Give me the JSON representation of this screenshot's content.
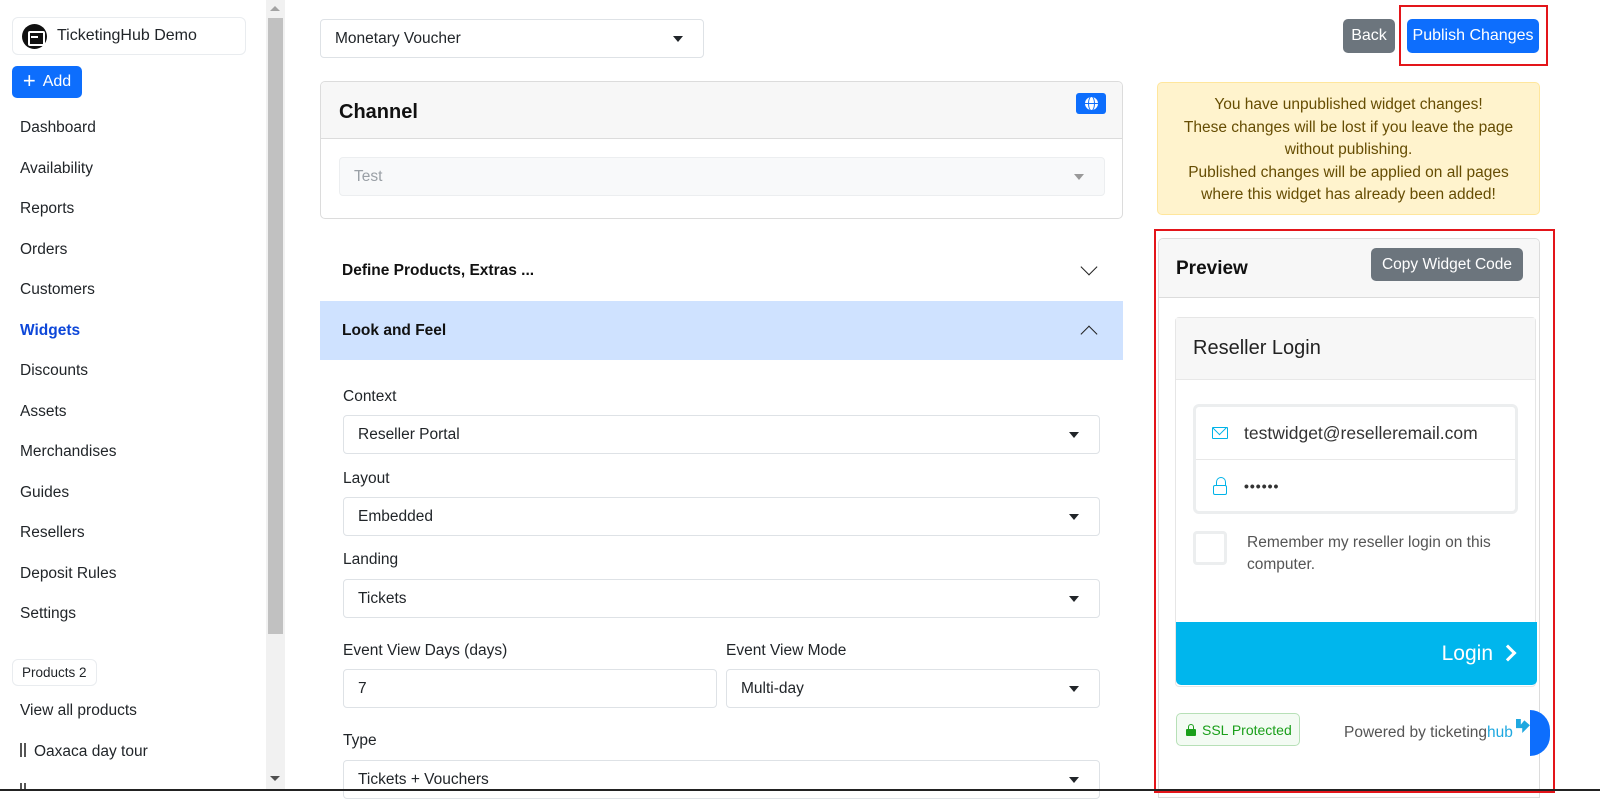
{
  "sidebar": {
    "brand": {
      "name": "TicketingHub Demo",
      "icon": "store-icon"
    },
    "add_label": "Add",
    "nav": [
      {
        "label": "Dashboard",
        "active": false
      },
      {
        "label": "Availability",
        "active": false
      },
      {
        "label": "Reports",
        "active": false
      },
      {
        "label": "Orders",
        "active": false
      },
      {
        "label": "Customers",
        "active": false
      },
      {
        "label": "Widgets",
        "active": true
      },
      {
        "label": "Discounts",
        "active": false
      },
      {
        "label": "Assets",
        "active": false
      },
      {
        "label": "Merchandises",
        "active": false
      },
      {
        "label": "Guides",
        "active": false
      },
      {
        "label": "Resellers",
        "active": false
      },
      {
        "label": "Deposit Rules",
        "active": false
      },
      {
        "label": "Settings",
        "active": false
      }
    ],
    "products_badge": "Products 2",
    "view_all": "View all products",
    "products": [
      "Oaxaca day tour"
    ]
  },
  "main": {
    "widget_type": "Monetary Voucher",
    "channel": {
      "title": "Channel",
      "value": "Test",
      "icon": "globe-icon"
    },
    "sections": [
      {
        "label": "Define Products, Extras ...",
        "open": false
      },
      {
        "label": "Look and Feel",
        "open": true
      }
    ],
    "fields": {
      "context": {
        "label": "Context",
        "value": "Reseller Portal"
      },
      "layout": {
        "label": "Layout",
        "value": "Embedded"
      },
      "landing": {
        "label": "Landing",
        "value": "Tickets"
      },
      "event_view_days": {
        "label": "Event View Days (days)",
        "value": "7"
      },
      "event_view_mode": {
        "label": "Event View Mode",
        "value": "Multi-day"
      },
      "type": {
        "label": "Type",
        "value": "Tickets + Vouchers"
      }
    }
  },
  "actions": {
    "back": "Back",
    "publish": "Publish Changes"
  },
  "alert": {
    "line1": "You have unpublished widget changes!",
    "line2": "These changes will be lost if you leave the page without publishing.",
    "line3": "Published changes will be applied on all pages where this widget has already been added!"
  },
  "preview": {
    "title": "Preview",
    "copy_label": "Copy Widget Code",
    "login": {
      "title": "Reseller Login",
      "email": "testwidget@reselleremail.com",
      "password": "••••••",
      "remember": "Remember my reseller login on this computer.",
      "remember_checked": false,
      "button": "Login",
      "ssl": "SSL Protected",
      "powered_prefix": "Powered by ",
      "powered_brand_a": "ticketing",
      "powered_brand_b": "hub"
    }
  },
  "colors": {
    "primary": "#0d6efd",
    "secondary": "#6c757d",
    "login_accent": "#00b6ed",
    "highlight": "#e3151a",
    "warning_bg": "#fff3cd",
    "accordion_open": "#cfe2ff"
  }
}
